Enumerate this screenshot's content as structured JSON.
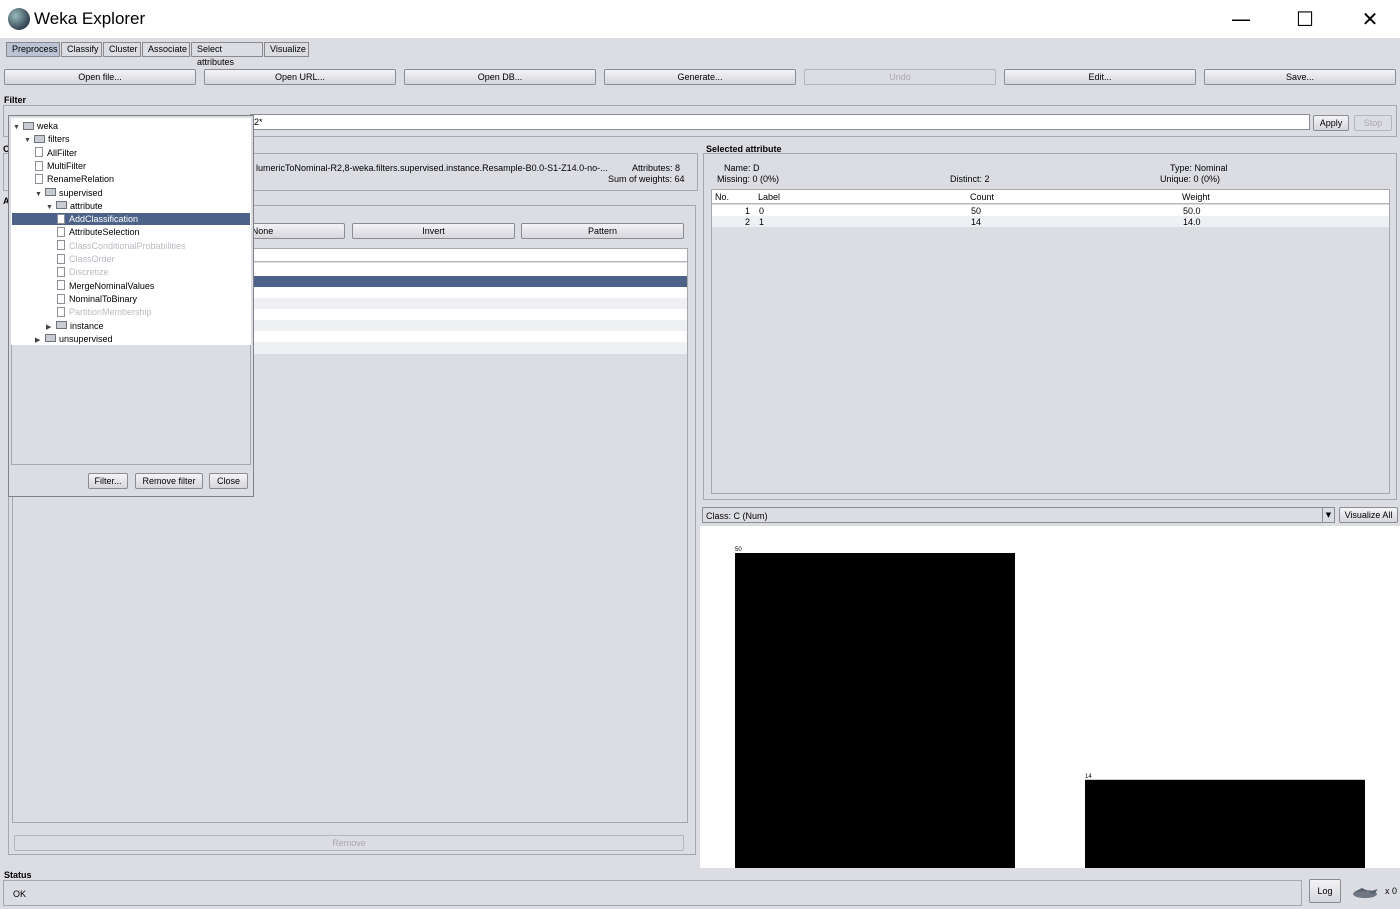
{
  "window": {
    "title": "Weka Explorer",
    "minimize": "—",
    "maximize": "☐",
    "close": "✕"
  },
  "tabs": [
    "Preprocess",
    "Classify",
    "Cluster",
    "Associate",
    "Select attributes",
    "Visualize"
  ],
  "toolbar": {
    "open_file": "Open file...",
    "open_url": "Open URL...",
    "open_db": "Open DB...",
    "generate": "Generate...",
    "undo": "Undo",
    "edit": "Edit...",
    "save": "Save..."
  },
  "filter": {
    "label": "Filter",
    "field_value": "2*",
    "apply": "Apply",
    "stop": "Stop"
  },
  "current_relation": {
    "label_fragment": "C",
    "relation_text": "lumericToNominal-R2,8-weka.filters.supervised.instance.Resample-B0.0-S1-Z14.0-no-...",
    "attributes": "Attributes: 8",
    "sum_of_weights": "Sum of weights: 64"
  },
  "attributes_panel": {
    "label_fragment": "A",
    "none": "None",
    "invert": "Invert",
    "pattern": "Pattern",
    "remove": "Remove"
  },
  "filter_tree": {
    "nodes": [
      {
        "label": "weka",
        "type": "folder",
        "toggle": "▼",
        "disabled": false
      },
      {
        "label": "filters",
        "type": "folder",
        "toggle": "▼",
        "disabled": false
      },
      {
        "label": "AllFilter",
        "type": "file",
        "toggle": "",
        "disabled": false
      },
      {
        "label": "MultiFilter",
        "type": "file",
        "toggle": "",
        "disabled": false
      },
      {
        "label": "RenameRelation",
        "type": "file",
        "toggle": "",
        "disabled": false
      },
      {
        "label": "supervised",
        "type": "folder",
        "toggle": "▼",
        "disabled": false
      },
      {
        "label": "attribute",
        "type": "folder",
        "toggle": "▼",
        "disabled": false
      },
      {
        "label": "AddClassification",
        "type": "file",
        "toggle": "",
        "disabled": false,
        "selected": true
      },
      {
        "label": "AttributeSelection",
        "type": "file",
        "toggle": "",
        "disabled": false
      },
      {
        "label": "ClassConditionalProbabilities",
        "type": "file",
        "toggle": "",
        "disabled": true
      },
      {
        "label": "ClassOrder",
        "type": "file",
        "toggle": "",
        "disabled": true
      },
      {
        "label": "Discretize",
        "type": "file",
        "toggle": "",
        "disabled": true
      },
      {
        "label": "MergeNominalValues",
        "type": "file",
        "toggle": "",
        "disabled": false
      },
      {
        "label": "NominalToBinary",
        "type": "file",
        "toggle": "",
        "disabled": false
      },
      {
        "label": "PartitionMembership",
        "type": "file",
        "toggle": "",
        "disabled": true
      },
      {
        "label": "instance",
        "type": "folder",
        "toggle": "▶",
        "disabled": false
      },
      {
        "label": "unsupervised",
        "type": "folder",
        "toggle": "▶",
        "disabled": false
      }
    ],
    "filter_button": "Filter...",
    "remove_filter_button": "Remove filter",
    "close_button": "Close"
  },
  "selected_attribute": {
    "label": "Selected attribute",
    "name": "Name: D",
    "type": "Type: Nominal",
    "missing": "Missing: 0 (0%)",
    "distinct": "Distinct: 2",
    "unique": "Unique: 0 (0%)",
    "columns": [
      "No.",
      "Label",
      "Count",
      "Weight"
    ],
    "rows": [
      [
        "1",
        "0",
        "50",
        "50.0"
      ],
      [
        "2",
        "1",
        "14",
        "14.0"
      ]
    ]
  },
  "class_select": {
    "value": "Class: C (Num)",
    "visualize_all": "Visualize All"
  },
  "chart_data": {
    "type": "bar",
    "categories": [
      "0",
      "1"
    ],
    "values": [
      50,
      14
    ],
    "value_labels": [
      "50",
      "14"
    ],
    "ylim": [
      0,
      50
    ],
    "bar_color": "#000000"
  },
  "status": {
    "label": "Status",
    "text": "OK",
    "log": "Log",
    "count": "x 0"
  }
}
